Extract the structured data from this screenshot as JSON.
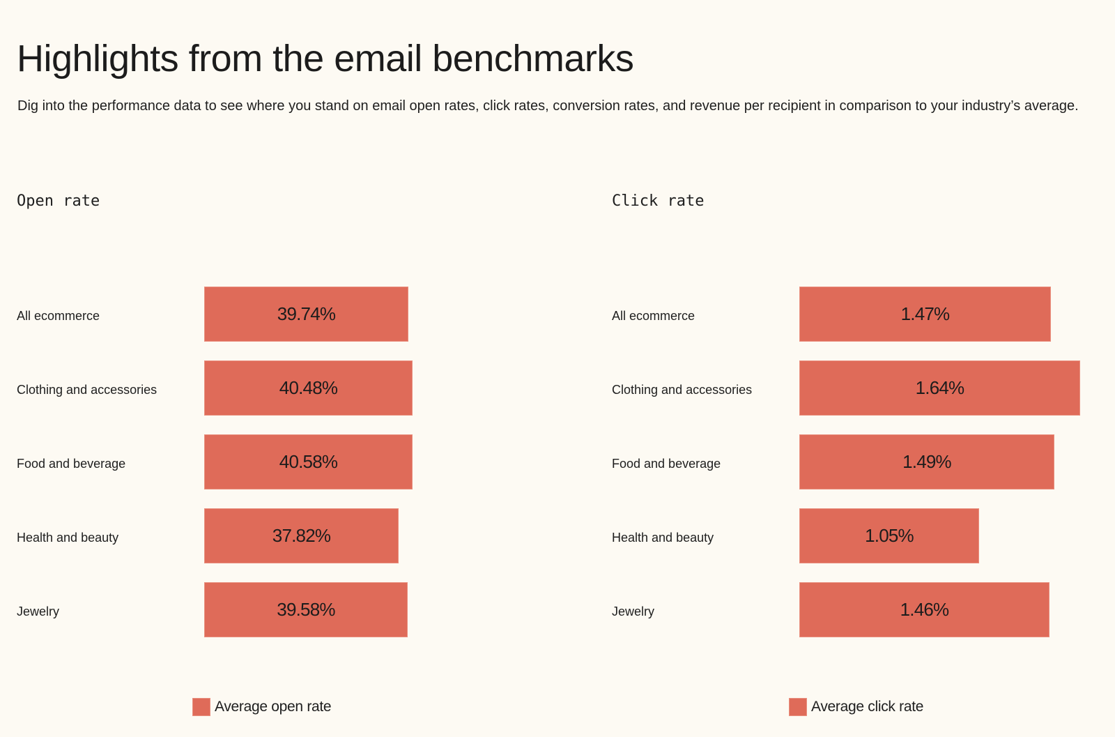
{
  "header": {
    "title": "Highlights from the email benchmarks",
    "description": "Dig into the performance data to see where you stand on email open rates, click rates, conversion rates, and revenue per recipient in comparison to your industry’s average."
  },
  "colors": {
    "bar": "#df6b59",
    "background": "#fdfaf3",
    "text": "#1e1e1e"
  },
  "chart_data": [
    {
      "type": "bar",
      "orientation": "horizontal",
      "title": "Open rate",
      "categories": [
        "All ecommerce",
        "Clothing and accessories",
        "Food and beverage",
        "Health and beauty",
        "Jewelry"
      ],
      "values": [
        39.74,
        40.48,
        40.58,
        37.82,
        39.58
      ],
      "value_labels": [
        "39.74%",
        "40.48%",
        "40.58%",
        "37.82%",
        "39.58%"
      ],
      "unit": "%",
      "xlabel": "",
      "ylabel": "",
      "xlim": [
        0,
        41
      ],
      "grid": false,
      "legend": {
        "position": "bottom",
        "entries": [
          "Average open rate"
        ]
      }
    },
    {
      "type": "bar",
      "orientation": "horizontal",
      "title": "Click rate",
      "categories": [
        "All ecommerce",
        "Clothing and accessories",
        "Food and beverage",
        "Health and beauty",
        "Jewelry"
      ],
      "values": [
        1.47,
        1.64,
        1.49,
        1.05,
        1.46
      ],
      "value_labels": [
        "1.47%",
        "1.64%",
        "1.49%",
        "1.05%",
        "1.46%"
      ],
      "unit": "%",
      "xlabel": "",
      "ylabel": "",
      "xlim": [
        0,
        1.64
      ],
      "grid": false,
      "legend": {
        "position": "bottom",
        "entries": [
          "Average click rate"
        ]
      }
    }
  ]
}
